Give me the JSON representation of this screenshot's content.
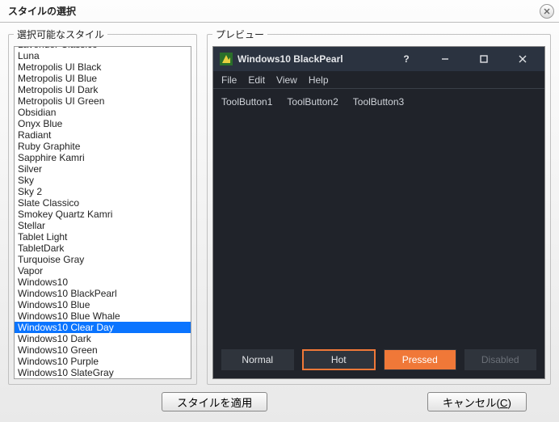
{
  "dialog": {
    "title": "スタイルの選択"
  },
  "left": {
    "legend": "選択可能なスタイル",
    "selected_index": 25,
    "items": [
      "Lavender Classico",
      "Luna",
      "Metropolis UI Black",
      "Metropolis UI Blue",
      "Metropolis UI Dark",
      "Metropolis UI Green",
      "Obsidian",
      "Onyx Blue",
      "Radiant",
      "Ruby Graphite",
      "Sapphire Kamri",
      "Silver",
      "Sky",
      "Sky 2",
      "Slate Classico",
      "Smokey Quartz Kamri",
      "Stellar",
      "Tablet Light",
      "TabletDark",
      "Turquoise Gray",
      "Vapor",
      "Windows10",
      "Windows10 BlackPearl",
      "Windows10 Blue",
      "Windows10 Blue Whale",
      "Windows10 Clear Day",
      "Windows10 Dark",
      "Windows10 Green",
      "Windows10 Purple",
      "Windows10 SlateGray"
    ]
  },
  "preview": {
    "legend": "プレビュー",
    "window_title": "Windows10 BlackPearl",
    "menu": {
      "file": "File",
      "edit": "Edit",
      "view": "View",
      "help": "Help"
    },
    "toolbuttons": {
      "b1": "ToolButton1",
      "b2": "ToolButton2",
      "b3": "ToolButton3"
    },
    "buttons": {
      "normal": "Normal",
      "hot": "Hot",
      "pressed": "Pressed",
      "disabled": "Disabled"
    },
    "colors": {
      "bg": "#20232a",
      "titlebar": "#2b3340",
      "accent": "#f07838",
      "text": "#d0d3d8"
    }
  },
  "footer": {
    "apply": "スタイルを適用",
    "cancel_prefix": "キャンセル(",
    "cancel_mnemonic": "C",
    "cancel_suffix": ")"
  }
}
